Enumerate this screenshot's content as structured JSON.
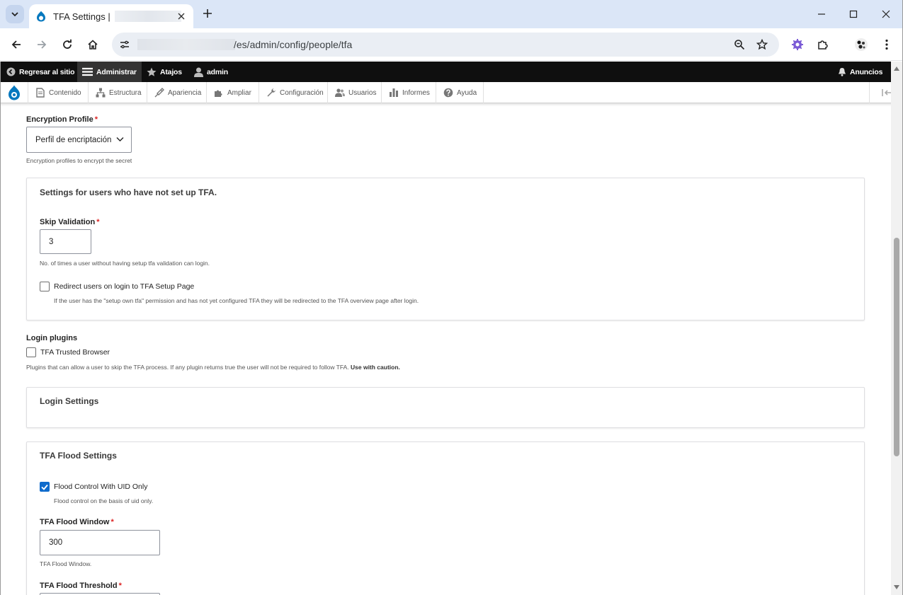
{
  "browser": {
    "tab_title": "TFA Settings |",
    "url_suffix": "/es/admin/config/people/tfa"
  },
  "admin_toolbar": {
    "back_to_site": "Regresar al sitio",
    "manage": "Administrar",
    "shortcuts": "Atajos",
    "user": "admin",
    "announcements": "Anuncios"
  },
  "admin_menu": {
    "items": [
      {
        "label": "Contenido",
        "icon": "content-icon"
      },
      {
        "label": "Estructura",
        "icon": "structure-icon"
      },
      {
        "label": "Apariencia",
        "icon": "appearance-icon"
      },
      {
        "label": "Ampliar",
        "icon": "extend-icon"
      },
      {
        "label": "Configuración",
        "icon": "wrench-icon"
      },
      {
        "label": "Usuarios",
        "icon": "people-icon"
      },
      {
        "label": "Informes",
        "icon": "reports-icon"
      },
      {
        "label": "Ayuda",
        "icon": "help-icon"
      }
    ]
  },
  "form": {
    "encryption_profile": {
      "label": "Encryption Profile",
      "required_mark": "*",
      "value": "Perfil de encriptación",
      "description": "Encryption profiles to encrypt the secret"
    },
    "setup_fieldset": {
      "legend": "Settings for users who have not set up TFA.",
      "skip_validation": {
        "label": "Skip Validation",
        "required_mark": "*",
        "value": "3",
        "description": "No. of times a user without having setup tfa validation can login."
      },
      "redirect": {
        "label": "Redirect users on login to TFA Setup Page",
        "checked": false,
        "description": "If the user has the \"setup own tfa\" permission and has not yet configured TFA they will be redirected to the TFA overview page after login."
      }
    },
    "login_plugins": {
      "label": "Login plugins",
      "option": "TFA Trusted Browser",
      "checked": false,
      "description": "Plugins that can allow a user to skip the TFA process. If any plugin returns true the user will not be required to follow TFA.",
      "caution": "Use with caution."
    },
    "login_settings": {
      "legend": "Login Settings"
    },
    "flood_fieldset": {
      "legend": "TFA Flood Settings",
      "uid_only": {
        "label": "Flood Control With UID Only",
        "checked": true,
        "description": "Flood control on the basis of uid only."
      },
      "flood_window": {
        "label": "TFA Flood Window",
        "required_mark": "*",
        "value": "300",
        "description": "TFA Flood Window."
      },
      "flood_threshold": {
        "label": "TFA Flood Threshold",
        "required_mark": "*"
      }
    }
  },
  "colors": {
    "drupal_blue": "#0678be",
    "checkbox_checked": "#0f6bcc",
    "required": "#dc2323",
    "toolbar_bg": "#0f0f0f",
    "tabbar_bg": "#dbe6f7"
  }
}
